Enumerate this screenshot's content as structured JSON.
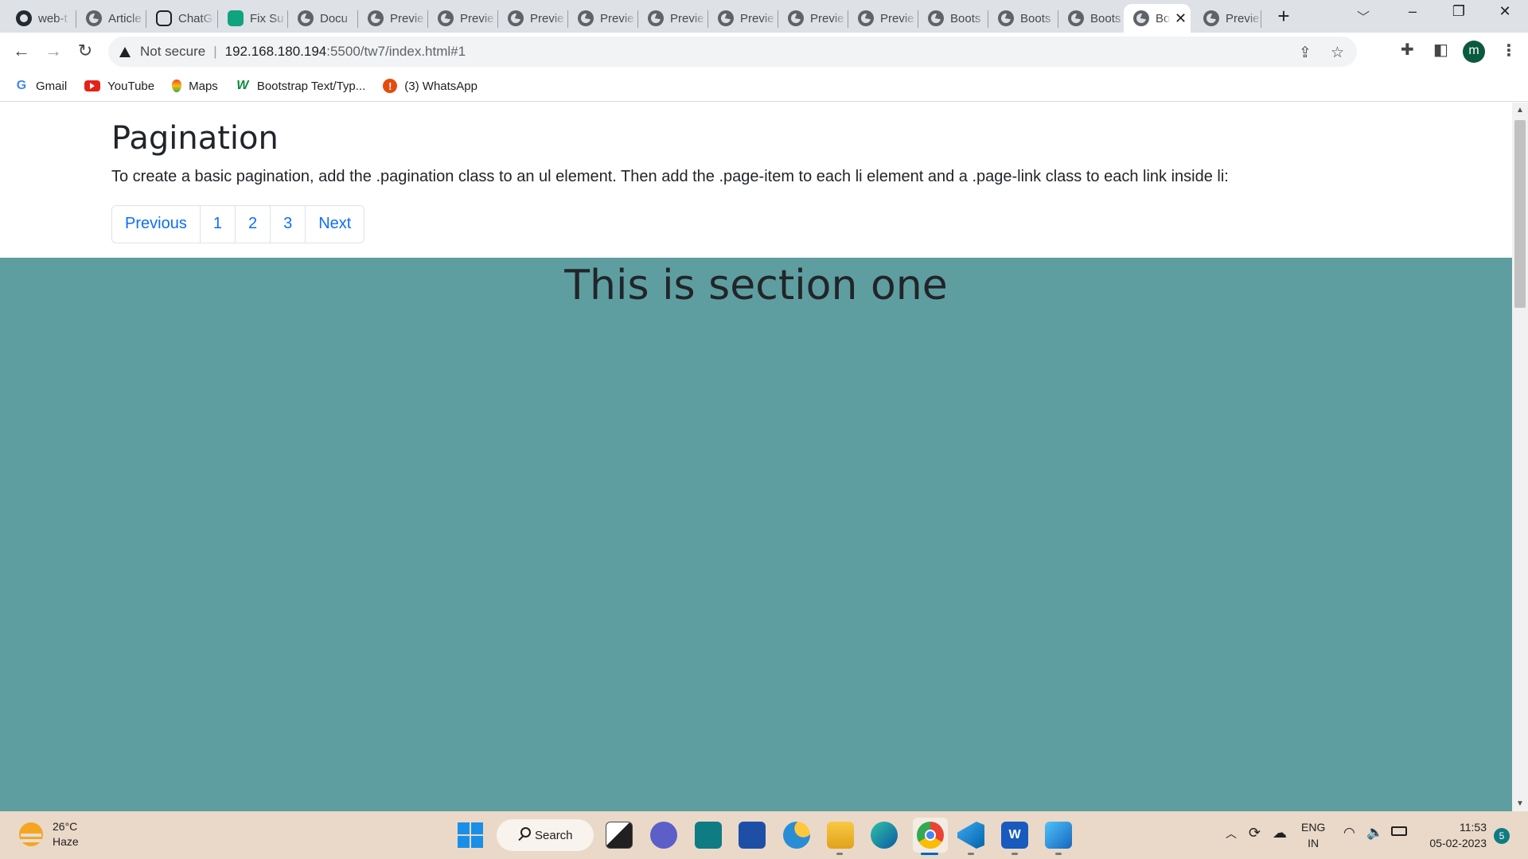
{
  "browser": {
    "tabs": [
      {
        "label": "web-t",
        "icon": "github-icon",
        "active": false
      },
      {
        "label": "Article",
        "icon": "globe-icon",
        "active": false
      },
      {
        "label": "ChatGPT",
        "icon": "chatgpt-icon",
        "active": false
      },
      {
        "label": "Fix Su",
        "icon": "chatgpt-icon",
        "active": false
      },
      {
        "label": "Docu",
        "icon": "globe-icon",
        "active": false
      },
      {
        "label": "Previe",
        "icon": "globe-icon",
        "active": false
      },
      {
        "label": "Previe",
        "icon": "globe-icon",
        "active": false
      },
      {
        "label": "Previe",
        "icon": "globe-icon",
        "active": false
      },
      {
        "label": "Previe",
        "icon": "globe-icon",
        "active": false
      },
      {
        "label": "Previe",
        "icon": "globe-icon",
        "active": false
      },
      {
        "label": "Previe",
        "icon": "globe-icon",
        "active": false
      },
      {
        "label": "Previe",
        "icon": "globe-icon",
        "active": false
      },
      {
        "label": "Previe",
        "icon": "globe-icon",
        "active": false
      },
      {
        "label": "Boots",
        "icon": "globe-icon",
        "active": false
      },
      {
        "label": "Boots",
        "icon": "globe-icon",
        "active": false
      },
      {
        "label": "Boots",
        "icon": "globe-icon",
        "active": false
      },
      {
        "label": "Bo",
        "icon": "globe-icon",
        "active": true
      },
      {
        "label": "Previe",
        "icon": "globe-icon",
        "active": false
      }
    ],
    "security_label": "Not secure",
    "url_host": "192.168.180.194",
    "url_path": ":5500/tw7/index.html#1",
    "profile_initial": "m",
    "bookmarks": [
      {
        "label": "Gmail",
        "icon": "google-icon"
      },
      {
        "label": "YouTube",
        "icon": "youtube-icon"
      },
      {
        "label": "Maps",
        "icon": "maps-icon"
      },
      {
        "label": "Bootstrap Text/Typ...",
        "icon": "w3schools-icon"
      },
      {
        "label": "(3) WhatsApp",
        "icon": "whatsapp-icon"
      }
    ]
  },
  "page": {
    "title": "Pagination",
    "description": "To create a basic pagination, add the .pagination class to an ul element. Then add the .page-item to each li element and a .page-link class to each link inside li:",
    "pagination": [
      "Previous",
      "1",
      "2",
      "3",
      "Next"
    ],
    "section_title": "This is section one",
    "section_color": "#5f9ea0",
    "link_color": "#0d6efd"
  },
  "taskbar": {
    "temperature": "26°C",
    "weather": "Haze",
    "search_label": "Search",
    "language": "ENG",
    "region": "IN",
    "time": "11:53",
    "date": "05-02-2023",
    "notification_count": "5"
  }
}
